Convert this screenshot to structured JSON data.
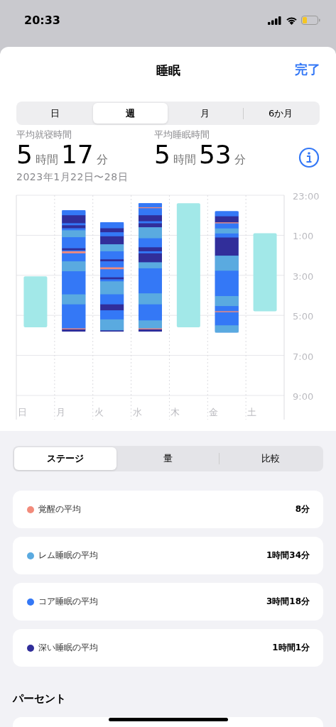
{
  "status_bar": {
    "time": "20:33"
  },
  "header": {
    "title": "睡眠",
    "done": "完了"
  },
  "range_tabs": [
    {
      "label": "日",
      "selected": false
    },
    {
      "label": "週",
      "selected": true
    },
    {
      "label": "月",
      "selected": false
    },
    {
      "label": "6か月",
      "selected": false
    }
  ],
  "stats": [
    {
      "label": "平均就寝時間",
      "parts": [
        {
          "kind": "num",
          "text": "5"
        },
        {
          "kind": "unit",
          "text": "時間"
        },
        {
          "kind": "num",
          "text": "17"
        },
        {
          "kind": "unit",
          "text": "分"
        }
      ]
    },
    {
      "label": "平均睡眠時間",
      "parts": [
        {
          "kind": "num",
          "text": "5"
        },
        {
          "kind": "unit",
          "text": "時間"
        },
        {
          "kind": "num",
          "text": "53"
        },
        {
          "kind": "unit",
          "text": "分"
        }
      ]
    }
  ],
  "date_range": "2023年1月22日〜28日",
  "chart": {
    "day_labels": [
      "日",
      "月",
      "火",
      "水",
      "木",
      "金",
      "土"
    ],
    "time_labels": [
      "23:00",
      "1:00",
      "3:00",
      "5:00",
      "7:00",
      "9:00"
    ]
  },
  "view_tabs": [
    {
      "label": "ステージ",
      "selected": true
    },
    {
      "label": "量",
      "selected": false
    },
    {
      "label": "比較",
      "selected": false
    }
  ],
  "averages": [
    {
      "label": "覚醒の平均",
      "value": "8分",
      "color": "#f28b7b"
    },
    {
      "label": "レム睡眠の平均",
      "value": "1時間34分",
      "color": "#5aaae0"
    },
    {
      "label": "コア睡眠の平均",
      "value": "3時間18分",
      "color": "#3478f6"
    },
    {
      "label": "深い睡眠の平均",
      "value": "1時間1分",
      "color": "#312e9a"
    }
  ],
  "section_title": "パーセント"
}
